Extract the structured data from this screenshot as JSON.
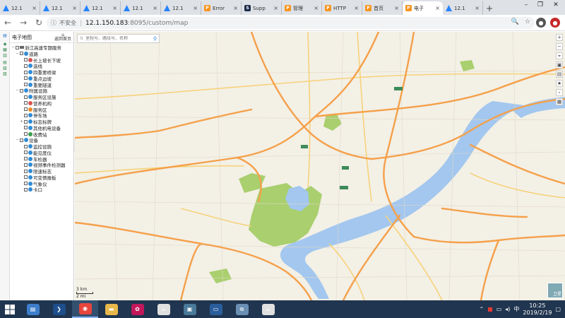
{
  "browser": {
    "tabs": [
      {
        "label": "12.1",
        "favicon": "jira-icon"
      },
      {
        "label": "12.1",
        "favicon": "jira-icon"
      },
      {
        "label": "12.1",
        "favicon": "jira-icon"
      },
      {
        "label": "12.1",
        "favicon": "jira-icon"
      },
      {
        "label": "12.1",
        "favicon": "jira-icon"
      },
      {
        "label": "Error",
        "favicon": "ip-icon"
      },
      {
        "label": "Supp",
        "favicon": "sup-icon"
      },
      {
        "label": "管理",
        "favicon": "ip-icon"
      },
      {
        "label": "HTTP",
        "favicon": "ip-icon"
      },
      {
        "label": "首页",
        "favicon": "ip-icon"
      },
      {
        "label": "电子",
        "favicon": "ip-icon",
        "active": true
      },
      {
        "label": "12.1",
        "favicon": "jira-icon"
      }
    ],
    "new_tab": "+",
    "window_controls": {
      "minimize": "–",
      "maximize": "❐",
      "close": "✕"
    },
    "address": {
      "security_label": "不安全",
      "separator": "|",
      "host": "12.1.150.183",
      "path": ":8095/custom/map"
    }
  },
  "tree": {
    "title": "电子地图",
    "home_label": "返回首页",
    "nodes": [
      {
        "label": "浙江高速专题服务",
        "level": 0,
        "icon": "bar",
        "toggle": "−"
      },
      {
        "label": "道路",
        "level": 1,
        "icon": "blue",
        "toggle": "−"
      },
      {
        "label": "长上坡长下坡",
        "level": 2,
        "icon": "red"
      },
      {
        "label": "选线",
        "level": 2,
        "icon": "blue"
      },
      {
        "label": "四重要桥梁",
        "level": 2,
        "icon": "blue"
      },
      {
        "label": "重点边坡",
        "level": 2,
        "icon": "blue"
      },
      {
        "label": "重要隧道",
        "level": 2,
        "icon": "blue"
      },
      {
        "label": "附属设施",
        "level": 1,
        "icon": "blue",
        "toggle": "−"
      },
      {
        "label": "服务区设施",
        "level": 2,
        "icon": "blue"
      },
      {
        "label": "营养机构",
        "level": 2,
        "icon": "red"
      },
      {
        "label": "服务区",
        "level": 2,
        "icon": "orange"
      },
      {
        "label": "停车场",
        "level": 2,
        "icon": "blue"
      },
      {
        "label": "标志标牌",
        "level": 2,
        "icon": "blue",
        "toggle": "+"
      },
      {
        "label": "其他机电设备",
        "level": 2,
        "icon": "blue"
      },
      {
        "label": "收费站",
        "level": 2,
        "icon": "green"
      },
      {
        "label": "设备",
        "level": 1,
        "icon": "blue",
        "toggle": "−"
      },
      {
        "label": "监控设施",
        "level": 2,
        "icon": "blue"
      },
      {
        "label": "能见度仪",
        "level": 2,
        "icon": "blue"
      },
      {
        "label": "车检器",
        "level": 2,
        "icon": "blue"
      },
      {
        "label": "视频事件检测器",
        "level": 2,
        "icon": "blue"
      },
      {
        "label": "限速标志",
        "level": 2,
        "icon": "blue"
      },
      {
        "label": "可变情报板",
        "level": 2,
        "icon": "blue"
      },
      {
        "label": "气象仪",
        "level": 2,
        "icon": "blue"
      },
      {
        "label": "卡口",
        "level": 2,
        "icon": "blue"
      }
    ]
  },
  "map": {
    "search_placeholder": "里程号、路段号、名称",
    "scale_km": "3 km",
    "scale_mi": "2 mi",
    "satellite_label": "卫星",
    "colors": {
      "background": "#f3f0e6",
      "highway": "#f5a04a",
      "road": "#f7d27a",
      "water": "#a3c7ef",
      "green": "#a9cf6e"
    }
  },
  "taskbar": {
    "apps": [
      "file-manager-icon",
      "powershell-icon",
      "chrome-icon",
      "folder-icon",
      "photos-icon",
      "java-icon",
      "window-icon",
      "remote-desktop-icon",
      "network-icon",
      "java-icon"
    ],
    "clock_time": "10:25",
    "clock_date": "2019/2/19"
  }
}
